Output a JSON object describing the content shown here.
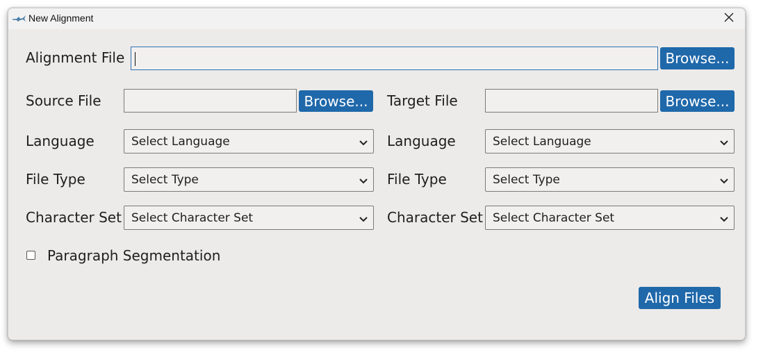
{
  "window": {
    "title": "New Alignment",
    "close_icon": "close-icon",
    "app_icon": "fish-icon"
  },
  "alignment": {
    "label": "Alignment File",
    "value": "",
    "browse_label": "Browse..."
  },
  "source": {
    "file_label": "Source File",
    "file_value": "",
    "browse_label": "Browse...",
    "language_label": "Language",
    "language_value": "Select Language",
    "type_label": "File Type",
    "type_value": "Select Type",
    "charset_label": "Character Set",
    "charset_value": "Select Character Set"
  },
  "target": {
    "file_label": "Target File",
    "file_value": "",
    "browse_label": "Browse...",
    "language_label": "Language",
    "language_value": "Select Language",
    "type_label": "File Type",
    "type_value": "Select Type",
    "charset_label": "Character Set",
    "charset_value": "Select Character Set"
  },
  "options": {
    "paragraph_segmentation_label": "Paragraph Segmentation",
    "paragraph_segmentation_checked": false
  },
  "actions": {
    "align_label": "Align Files"
  },
  "colors": {
    "button_blue": "#1f68aa",
    "window_bg": "#ecebe9",
    "focus_border": "#2e6fb3"
  }
}
